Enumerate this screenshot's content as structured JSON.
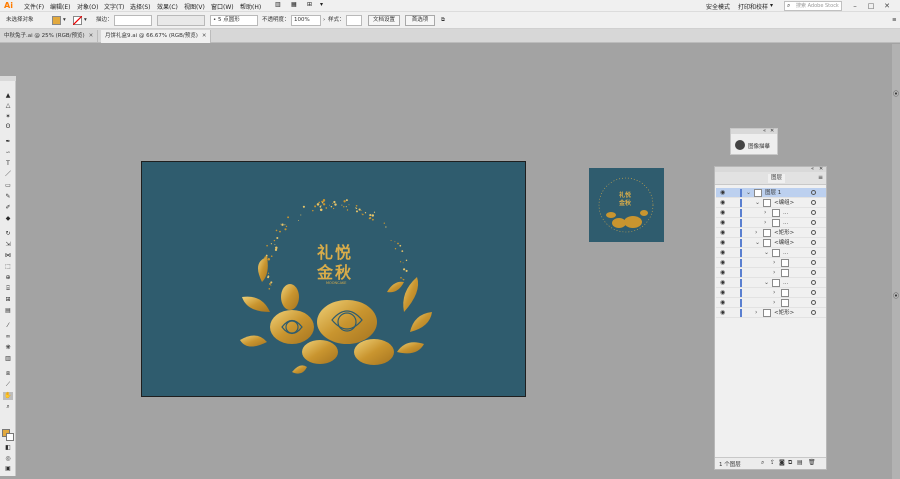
{
  "app": {
    "logo": "Ai"
  },
  "menu": [
    "文件(F)",
    "编辑(E)",
    "对象(O)",
    "文字(T)",
    "选择(S)",
    "效果(C)",
    "视图(V)",
    "窗口(W)",
    "帮助(H)"
  ],
  "top_right": {
    "workspace": "安全模式",
    "arrange": "打印和校样",
    "search_placeholder": "搜索 Adobe Stock"
  },
  "control": {
    "selection": "未选择对象",
    "stroke_label": "描边：",
    "stroke_value": "",
    "brush": "5 点圆形",
    "opacity_label": "不透明度：",
    "opacity_value": "100%",
    "style_label": "样式：",
    "doc_setup": "文档设置",
    "prefs": "首选项"
  },
  "tabs": [
    {
      "label": "中秋兔子.ai @ 25% (RGB/预览)",
      "active": false
    },
    {
      "label": "月饼礼盒9.ai @ 66.67% (RGB/预览)",
      "active": true
    }
  ],
  "tools": [
    "select",
    "direct",
    "magic",
    "lasso",
    "pen",
    "curvature",
    "type",
    "line",
    "rect",
    "brush",
    "shaper",
    "pencil",
    "eraser",
    "rotate",
    "scale",
    "width",
    "warp",
    "shape-builder",
    "perspective",
    "mesh",
    "gradient",
    "eyedropper",
    "blend",
    "symbol",
    "graph",
    "artboard",
    "slice",
    "hand",
    "zoom"
  ],
  "artwork": {
    "title_line1": "礼悦",
    "title_line2": "金秋",
    "subtitle": "MOONCAKE"
  },
  "nav_panel": {
    "label": "图像描摹"
  },
  "layers_panel": {
    "tab": "图层",
    "rows": [
      {
        "indent": 0,
        "expanded": true,
        "name": "图层 1",
        "selected": true
      },
      {
        "indent": 1,
        "expanded": true,
        "name": "<编组>"
      },
      {
        "indent": 2,
        "expanded": false,
        "name": "..."
      },
      {
        "indent": 2,
        "expanded": false,
        "name": "..."
      },
      {
        "indent": 1,
        "expanded": false,
        "name": "<矩形>"
      },
      {
        "indent": 1,
        "expanded": true,
        "name": "<编组>"
      },
      {
        "indent": 2,
        "expanded": true,
        "name": "..."
      },
      {
        "indent": 3,
        "expanded": false,
        "name": ""
      },
      {
        "indent": 3,
        "expanded": false,
        "name": ""
      },
      {
        "indent": 2,
        "expanded": true,
        "name": "..."
      },
      {
        "indent": 3,
        "expanded": false,
        "name": ""
      },
      {
        "indent": 3,
        "expanded": false,
        "name": ""
      },
      {
        "indent": 1,
        "expanded": false,
        "name": "<矩形>"
      }
    ],
    "footer": "1 个图层"
  },
  "colors": {
    "artboard": "#2f5c6e",
    "gold": "#c9952f",
    "gold_light": "#e7c46a",
    "accent": "#ff7c00"
  }
}
